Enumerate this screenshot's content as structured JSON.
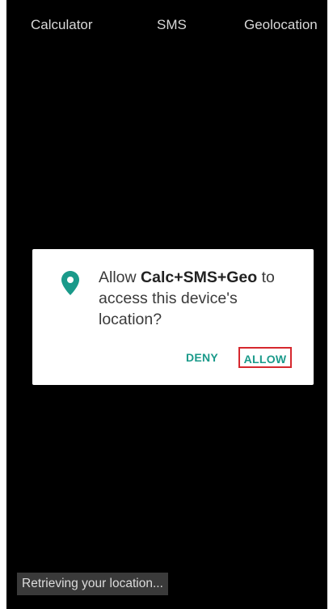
{
  "tabs": [
    {
      "label": "Calculator"
    },
    {
      "label": "SMS"
    },
    {
      "label": "Geolocation"
    }
  ],
  "dialog": {
    "prefix": "Allow ",
    "app_name": "Calc+SMS+Geo",
    "suffix": " to access this device's location?",
    "deny_label": "DENY",
    "allow_label": "ALLOW",
    "icon": "location-pin-icon",
    "accent_color": "#1a9a8a",
    "highlight_color": "#d6282e"
  },
  "toast": {
    "text": "Retrieving your location..."
  }
}
